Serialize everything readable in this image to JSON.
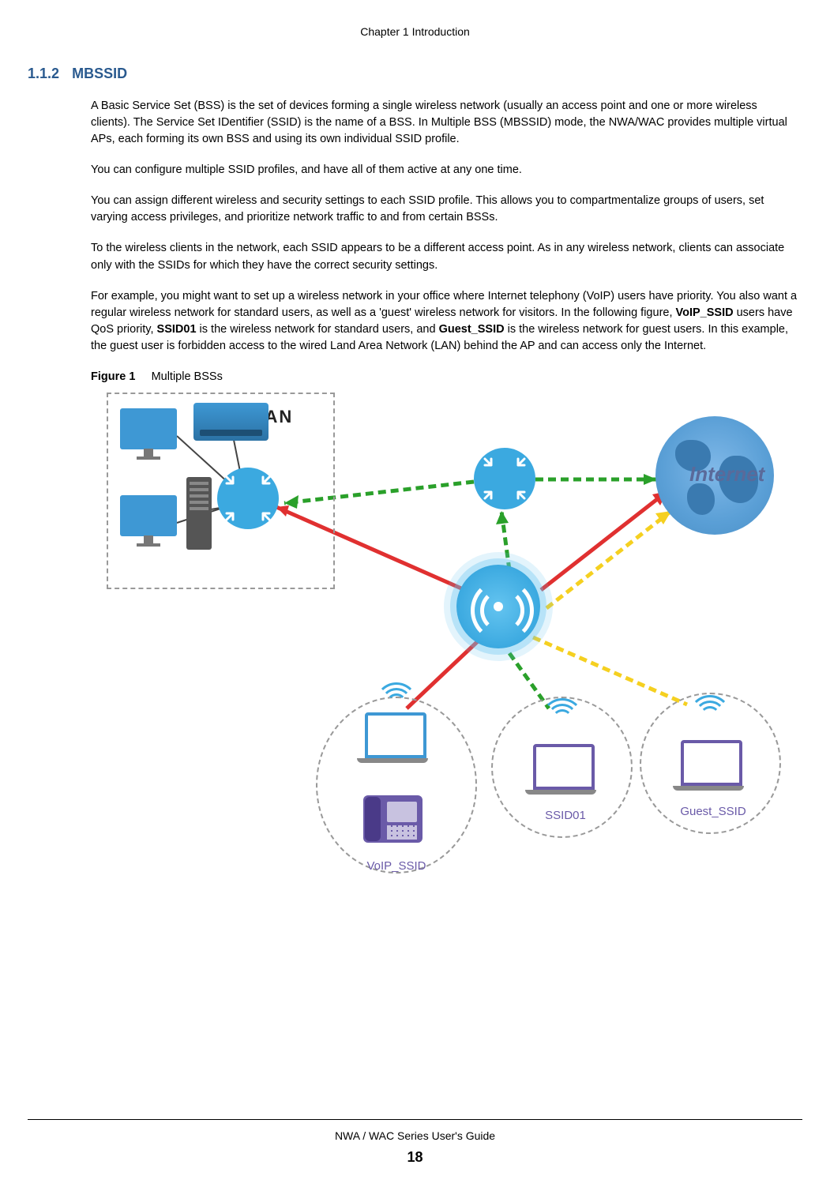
{
  "chapter_header": "Chapter 1 Introduction",
  "section": {
    "number": "1.1.2",
    "title": "MBSSID"
  },
  "paragraphs": {
    "p1": "A Basic Service Set (BSS) is the set of devices forming a single wireless network (usually an access point and one or more wireless clients). The Service Set IDentifier (SSID) is the name of a BSS. In Multiple BSS (MBSSID) mode, the NWA/WAC provides multiple virtual APs, each forming its own BSS and using its own individual SSID profile.",
    "p2": "You can configure multiple SSID profiles, and have all of them active at any one time.",
    "p3": "You can assign different wireless and security settings to each SSID profile. This allows you to compartmentalize groups of users, set varying access privileges, and prioritize network traffic to and from certain BSSs.",
    "p4": "To the wireless clients in the network, each SSID appears to be a different access point. As in any wireless network, clients can associate only with the SSIDs for which they have the correct security settings.",
    "p5_a": "For example, you might want to set up a wireless network in your office where Internet telephony (VoIP) users have priority. You also want a regular wireless network for standard users, as well as a 'guest' wireless network for visitors. In the following figure, ",
    "p5_b1": "VoIP_SSID",
    "p5_c": " users have QoS priority, ",
    "p5_b2": "SSID01",
    "p5_d": " is the wireless network for standard users, and ",
    "p5_b3": "Guest_SSID",
    "p5_e": " is the wireless network for guest users. In this example, the guest user is forbidden access to the wired Land Area Network (LAN) behind the AP and can access only the Internet."
  },
  "figure": {
    "prefix": "Figure 1",
    "caption": "Multiple BSSs",
    "labels": {
      "lan": "LAN",
      "internet": "Internet",
      "voip": "VoIP_SSID",
      "ssid01": "SSID01",
      "guest": "Guest_SSID"
    }
  },
  "footer": {
    "guide": "NWA / WAC Series User's Guide",
    "page": "18"
  }
}
